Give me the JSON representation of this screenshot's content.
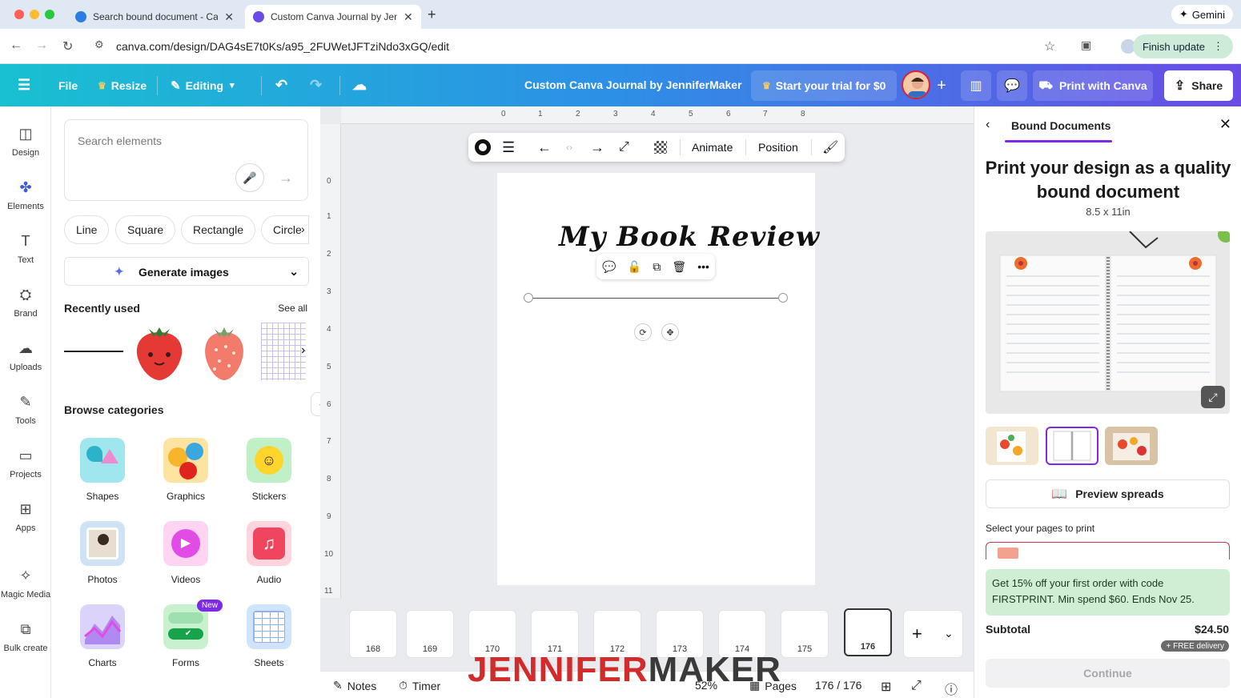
{
  "browser": {
    "tabs": [
      {
        "title": "Search bound document - Canva",
        "active": false
      },
      {
        "title": "Custom Canva Journal by JenniferMaker",
        "active": true
      }
    ],
    "new_tab": "+",
    "gemini": "Gemini",
    "url": "canva.com/design/DAG4sE7t0Ks/a95_2FUWetJFTziNdo3xGQ/edit",
    "finish_update": "Finish update"
  },
  "header": {
    "file": "File",
    "resize": "Resize",
    "editing": "Editing",
    "doc_title": "Custom Canva Journal by JenniferMaker",
    "trial": "Start your trial for $0",
    "print": "Print with Canva",
    "share": "Share"
  },
  "rail": [
    {
      "label": "Design",
      "icon": "design-icon"
    },
    {
      "label": "Elements",
      "icon": "elements-icon",
      "active": true
    },
    {
      "label": "Text",
      "icon": "text-icon"
    },
    {
      "label": "Brand",
      "icon": "brand-icon"
    },
    {
      "label": "Uploads",
      "icon": "uploads-icon"
    },
    {
      "label": "Tools",
      "icon": "tools-icon"
    },
    {
      "label": "Projects",
      "icon": "projects-icon"
    },
    {
      "label": "Apps",
      "icon": "apps-icon"
    },
    {
      "label": "Magic Media",
      "icon": "magic-media-icon"
    },
    {
      "label": "Bulk create",
      "icon": "bulk-create-icon"
    }
  ],
  "elements_panel": {
    "search_placeholder": "Search elements",
    "chips": [
      "Line",
      "Square",
      "Rectangle",
      "Circle"
    ],
    "generate": "Generate images",
    "recently_used": "Recently used",
    "see_all": "See all",
    "browse": "Browse categories",
    "categories": [
      "Shapes",
      "Graphics",
      "Stickers",
      "Photos",
      "Videos",
      "Audio",
      "Charts",
      "Forms",
      "Sheets"
    ],
    "new_badge": "New"
  },
  "canvas": {
    "ruler_h": [
      "0",
      "1",
      "2",
      "3",
      "4",
      "5",
      "6",
      "7",
      "8"
    ],
    "ruler_v": [
      "0",
      "1",
      "2",
      "3",
      "4",
      "5",
      "6",
      "7",
      "8",
      "9",
      "10",
      "11"
    ],
    "toolbar_animate": "Animate",
    "toolbar_position": "Position",
    "headline": "My Book Review",
    "pages": [
      "168",
      "169",
      "170",
      "171",
      "172",
      "173",
      "174",
      "175",
      "176"
    ]
  },
  "bottombar": {
    "notes": "Notes",
    "timer": "Timer",
    "zoom": "52%",
    "pages": "Pages",
    "page_count": "176 / 176"
  },
  "watermark": {
    "part1": "JENNIFER",
    "part2": "MAKER"
  },
  "right_panel": {
    "tab": "Bound Documents",
    "heading": "Print your design as a quality bound document",
    "size": "8.5 x 11in",
    "preview": "Preview spreads",
    "select_label": "Select your pages to print",
    "promo": "Get 15% off your first order with code FIRSTPRINT. Min spend $60. Ends Nov 25.",
    "subtotal_label": "Subtotal",
    "subtotal_value": "$24.50",
    "free_delivery": "+ FREE delivery",
    "continue": "Continue"
  },
  "colors": {
    "header_start": "#19c0d1",
    "header_end": "#6a4ce5",
    "accent": "#7d2ae8",
    "promo_bg": "#cfeed4"
  }
}
